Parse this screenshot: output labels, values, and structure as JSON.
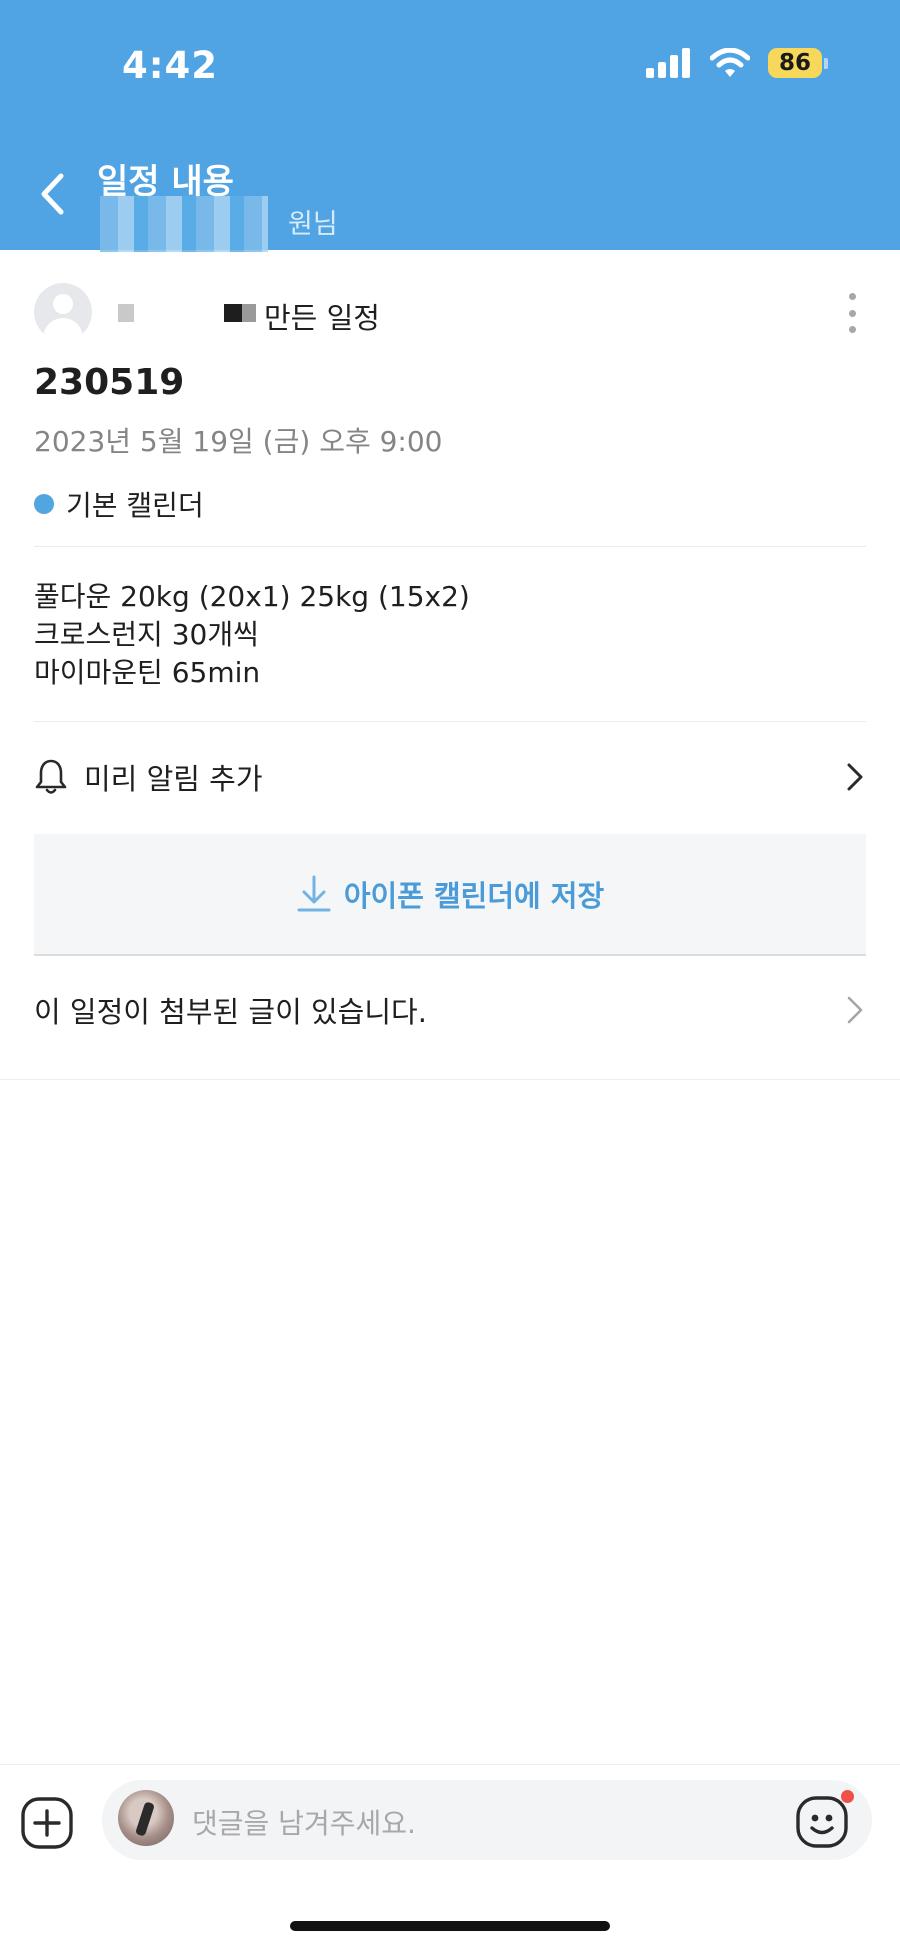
{
  "status_bar": {
    "time": "4:42",
    "battery": "86"
  },
  "nav": {
    "title": "일정 내용",
    "subtitle_visible": "원님"
  },
  "creator": {
    "label_suffix": "만든 일정"
  },
  "event": {
    "title": "230519",
    "datetime": "2023년 5월 19일 (금) 오후 9:00",
    "calendar_name": "기본 캘린더",
    "calendar_color": "#52a6e0",
    "notes": [
      "풀다운 20kg (20x1) 25kg (15x2)",
      "크로스런지 30개씩",
      "마이마운틴 65min"
    ]
  },
  "reminder": {
    "label": "미리 알림 추가"
  },
  "save": {
    "label": "아이폰 캘린더에 저장"
  },
  "attached": {
    "label": "이 일정이 첨부된 글이 있습니다."
  },
  "comment": {
    "placeholder": "댓글을 남겨주세요."
  },
  "colors": {
    "header": "#51a4e4",
    "accent": "#4a9bd7",
    "battery": "#f7d85a"
  }
}
